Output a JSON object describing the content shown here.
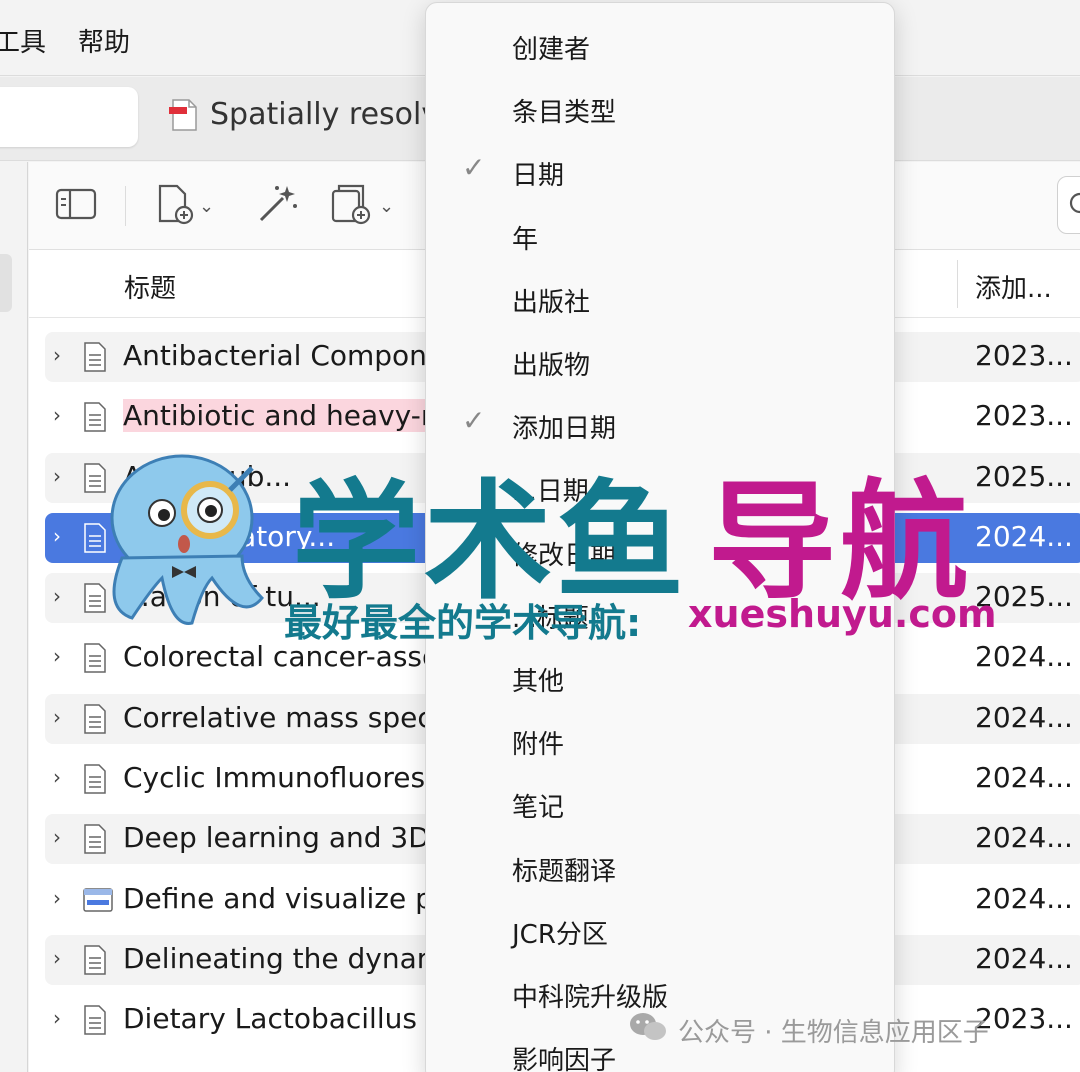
{
  "menubar": {
    "items": [
      "工具",
      "帮助"
    ]
  },
  "tabs": {
    "doc_title": "Spatially resolve"
  },
  "columns": {
    "title": "标题",
    "added": "添加..."
  },
  "rows": [
    {
      "title": "Antibacterial Compone",
      "date": "2023..."
    },
    {
      "title": "Antibiotic and heavy-m",
      "date": "2023..."
    },
    {
      "title": "Anti... sub...",
      "date": "2025..."
    },
    {
      "title": "...flammatory...",
      "date": "2024..."
    },
    {
      "title": "...ation of tu...",
      "date": "2025..."
    },
    {
      "title": "Colorectal cancer-asso",
      "date": "2024..."
    },
    {
      "title": "Correlative mass spect",
      "date": "2024..."
    },
    {
      "title": "Cyclic Immunofluoresc",
      "date": "2024..."
    },
    {
      "title": "Deep learning and 3D-",
      "date": "2024..."
    },
    {
      "title": "Define and visualize pa",
      "date": "2024..."
    },
    {
      "title": "Delineating the dynam",
      "date": "2024..."
    },
    {
      "title": "Dietary Lactobacillus c",
      "date": "2023..."
    }
  ],
  "column_menu": {
    "items": [
      {
        "label": "创建者",
        "checked": false
      },
      {
        "label": "条目类型",
        "checked": false
      },
      {
        "label": "日期",
        "checked": true
      },
      {
        "label": "年",
        "checked": false
      },
      {
        "label": "出版社",
        "checked": false
      },
      {
        "label": "出版物",
        "checked": false
      },
      {
        "label": "添加日期",
        "checked": true
      },
      {
        "label": "...日期",
        "checked": false
      },
      {
        "label": "修改日期",
        "checked": false
      },
      {
        "label": "...标题",
        "checked": false
      },
      {
        "label": "其他",
        "checked": false
      },
      {
        "label": "附件",
        "checked": false
      },
      {
        "label": "笔记",
        "checked": false
      },
      {
        "label": "标题翻译",
        "checked": false
      },
      {
        "label": "JCR分区",
        "checked": false
      },
      {
        "label": "中科院升级版",
        "checked": false
      },
      {
        "label": "影响因子",
        "checked": false
      }
    ],
    "check_glyph": "✓"
  },
  "watermark": {
    "title_part1": "学术鱼",
    "title_part2": "导航",
    "subtitle_part1": "最好最全的学术导航:",
    "subtitle_part2": "xueshuyu.com",
    "footer": "公众号 · 生物信息应用区子"
  },
  "colors": {
    "selection": "#4a79e0",
    "watermark_teal": "#137a8e",
    "watermark_magenta": "#c11a8e"
  },
  "icons": [
    "pane-toggle-icon",
    "new-item-icon",
    "magic-wand-icon",
    "add-attachment-icon",
    "search-icon",
    "pdf-icon",
    "document-icon",
    "webpage-icon",
    "wechat-icon"
  ]
}
